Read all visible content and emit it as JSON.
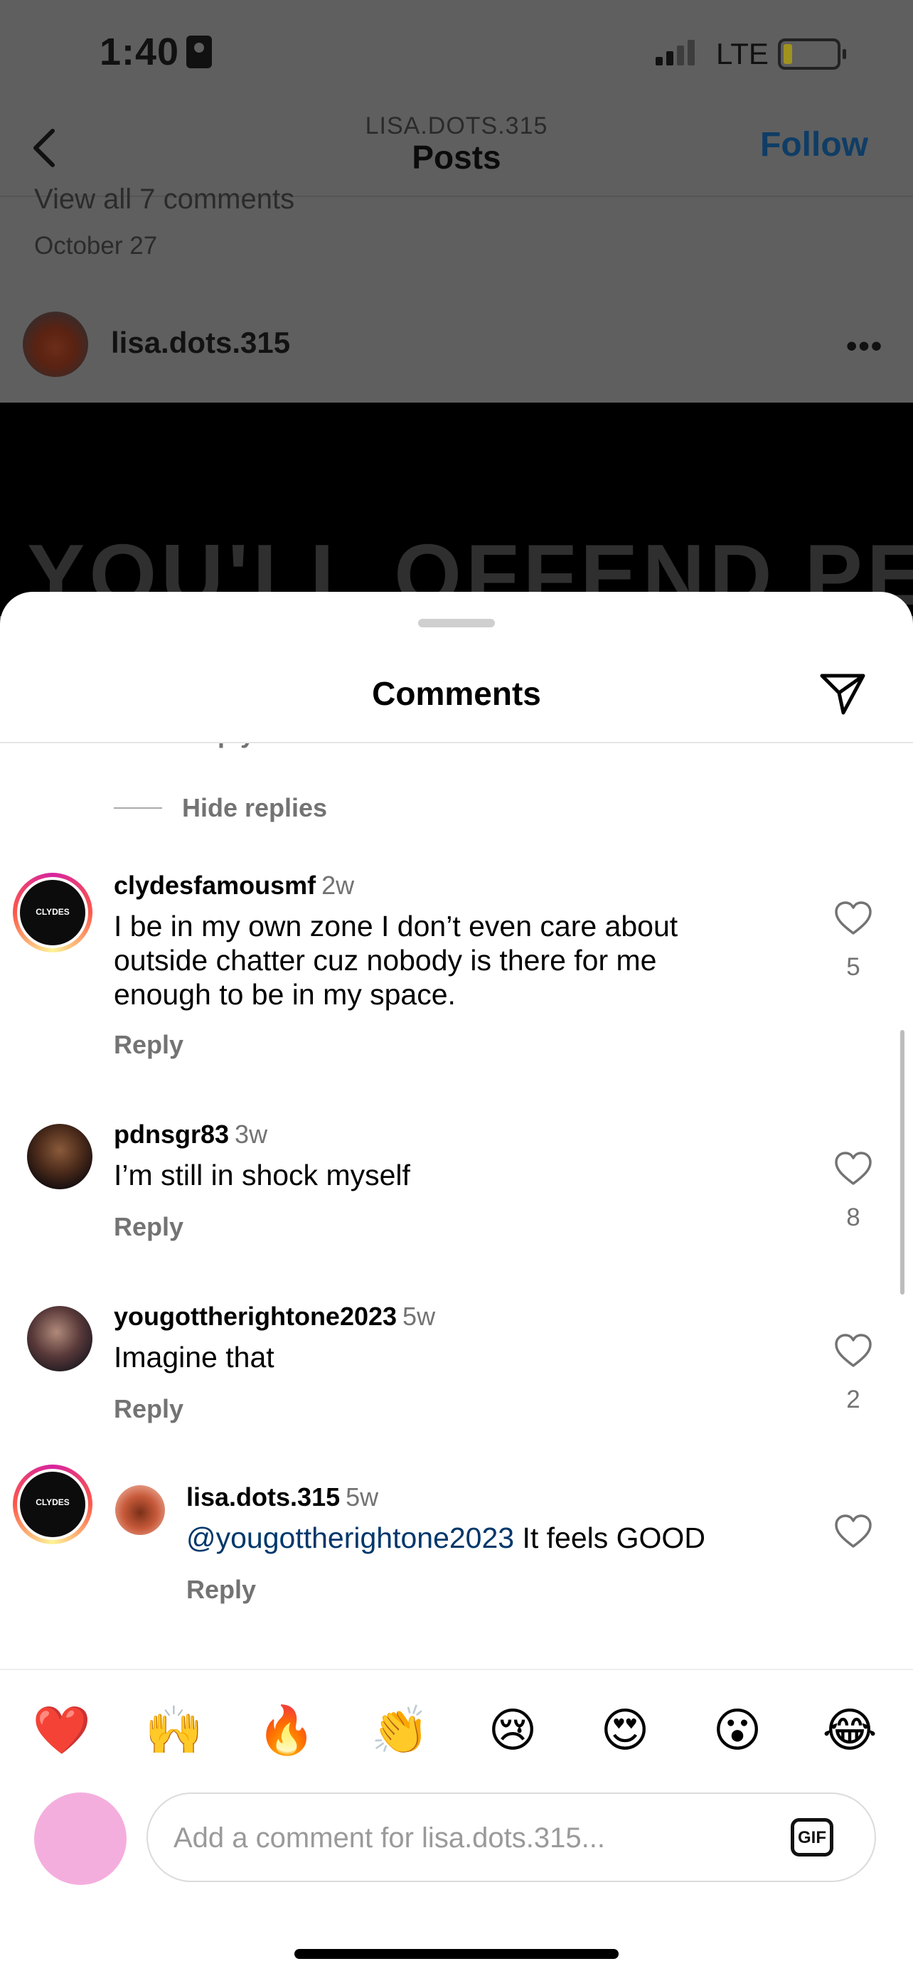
{
  "status_bar": {
    "time": "1:40",
    "network": "LTE"
  },
  "nav": {
    "subtitle": "LISA.DOTS.315",
    "title": "Posts",
    "follow_label": "Follow"
  },
  "post": {
    "view_comments": "View all 7 comments",
    "date": "October 27",
    "username": "lisa.dots.315",
    "more": "•••",
    "overlay_text": "YOU'LL OFFEND PEOPLE"
  },
  "sheet": {
    "title": "Comments",
    "partial_reply": "Reply",
    "hide_replies": "Hide replies"
  },
  "comments": [
    {
      "username": "clydesfamousmf",
      "time": "2w",
      "lines": [
        "I be in my own zone I don’t even care about",
        "outside chatter cuz nobody is there for me",
        "enough to be in my space."
      ],
      "reply": "Reply",
      "likes": "5",
      "avatar_text": "CLYDES"
    },
    {
      "username": "pdnsgr83",
      "time": "3w",
      "lines": [
        "I’m still in shock myself"
      ],
      "reply": "Reply",
      "likes": "8"
    },
    {
      "username": "yougottherightone2023",
      "time": "5w",
      "lines": [
        "Imagine that"
      ],
      "reply": "Reply",
      "likes": "2"
    },
    {
      "username": "lisa.dots.315",
      "time": "5w",
      "mention": "@yougottherightone2023",
      "text": " It feels GOOD",
      "reply": "Reply"
    }
  ],
  "reactions": [
    "❤️",
    "🙌",
    "🔥",
    "👏",
    "😢",
    "😍",
    "😮",
    "😂"
  ],
  "composer": {
    "placeholder": "Add a comment for lisa.dots.315...",
    "gif_label": "GIF"
  },
  "colors": {
    "follow": "#0095f6",
    "mention": "#00376b",
    "secondary_text": "#737373",
    "composer_avatar": "#f4aede"
  }
}
